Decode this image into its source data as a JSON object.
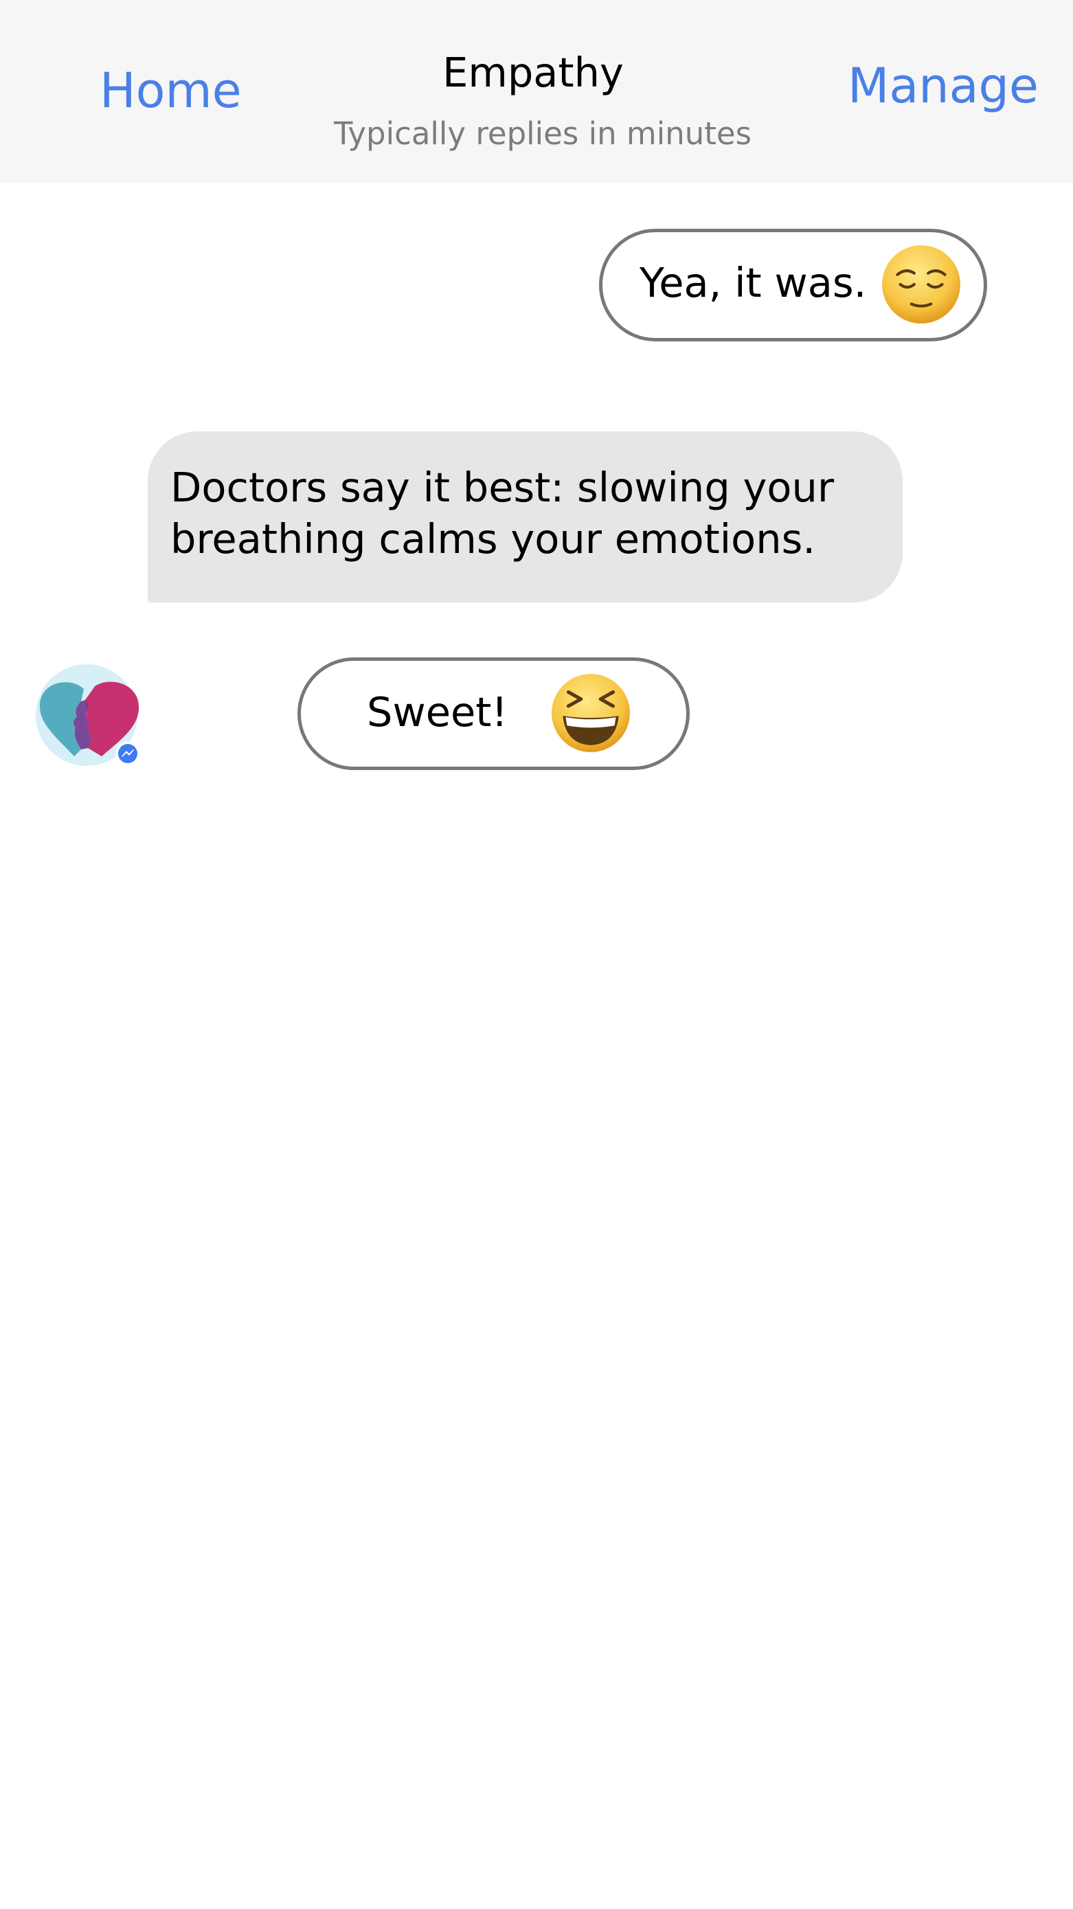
{
  "header": {
    "home_label": "Home",
    "title": "Empathy",
    "subtitle": "Typically replies in minutes",
    "manage_label": "Manage"
  },
  "messages": [
    {
      "from": "user",
      "text": "Yea, it was.",
      "emoji": "relieved-face-icon"
    },
    {
      "from": "bot",
      "lines": [
        "Doctors say it best: slowing your",
        "breathing calms your emotions."
      ]
    }
  ],
  "quick_reply": {
    "text": "Sweet!",
    "emoji": "grinning-squinting-face-icon"
  },
  "avatar": {
    "icon": "empathy-heart-faces-logo",
    "badge": "messenger-icon"
  },
  "colors": {
    "link": "#4a80e6",
    "header_bg": "#f6f6f6",
    "bot_bubble": "#e7e5e6",
    "pill_border": "#787878",
    "subtitle": "#7c7c7c"
  }
}
